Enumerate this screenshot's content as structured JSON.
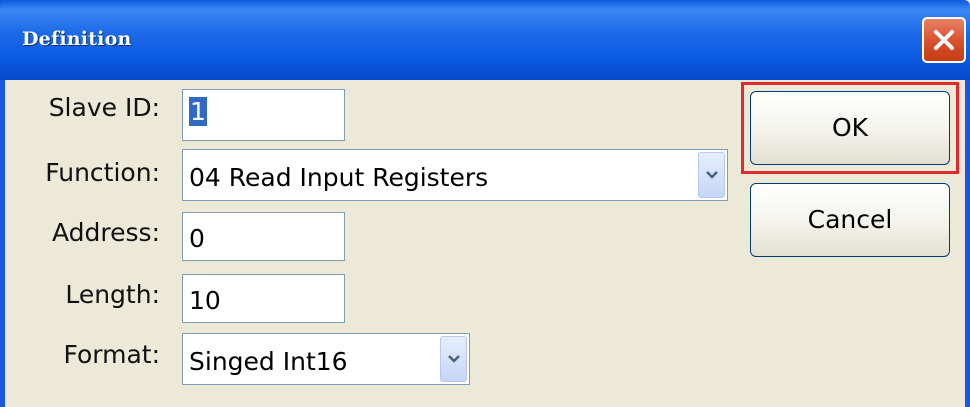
{
  "window": {
    "title": "Definition",
    "close_icon": "close-x-icon"
  },
  "form": {
    "slave_id": {
      "label": "Slave ID:",
      "value": "1"
    },
    "function": {
      "label": "Function:",
      "selected": "04 Read Input Registers"
    },
    "address": {
      "label": "Address:",
      "value": "0"
    },
    "length": {
      "label": "Length:",
      "value": "10"
    },
    "format": {
      "label": "Format:",
      "selected": "Singed Int16"
    }
  },
  "buttons": {
    "ok_label": "OK",
    "cancel_label": "Cancel"
  },
  "colors": {
    "titlebar": "#0a58e2",
    "highlight": "#e02a30",
    "selection": "#316ac5"
  }
}
